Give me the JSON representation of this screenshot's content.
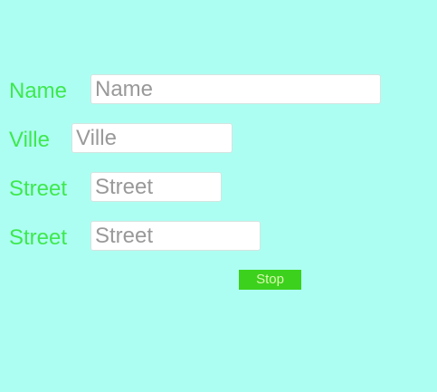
{
  "form": {
    "fields": [
      {
        "label": "Name",
        "placeholder": "Name",
        "value": ""
      },
      {
        "label": "Ville",
        "placeholder": "Ville",
        "value": ""
      },
      {
        "label": "Street",
        "placeholder": "Street",
        "value": ""
      },
      {
        "label": "Street",
        "placeholder": "Street",
        "value": ""
      }
    ],
    "stop_button_label": "Stop"
  },
  "colors": {
    "background": "#adfef2",
    "label_text": "#3ee84f",
    "button_background": "#3cd11c",
    "button_text": "#d9f7b0",
    "placeholder_text": "#999999"
  }
}
